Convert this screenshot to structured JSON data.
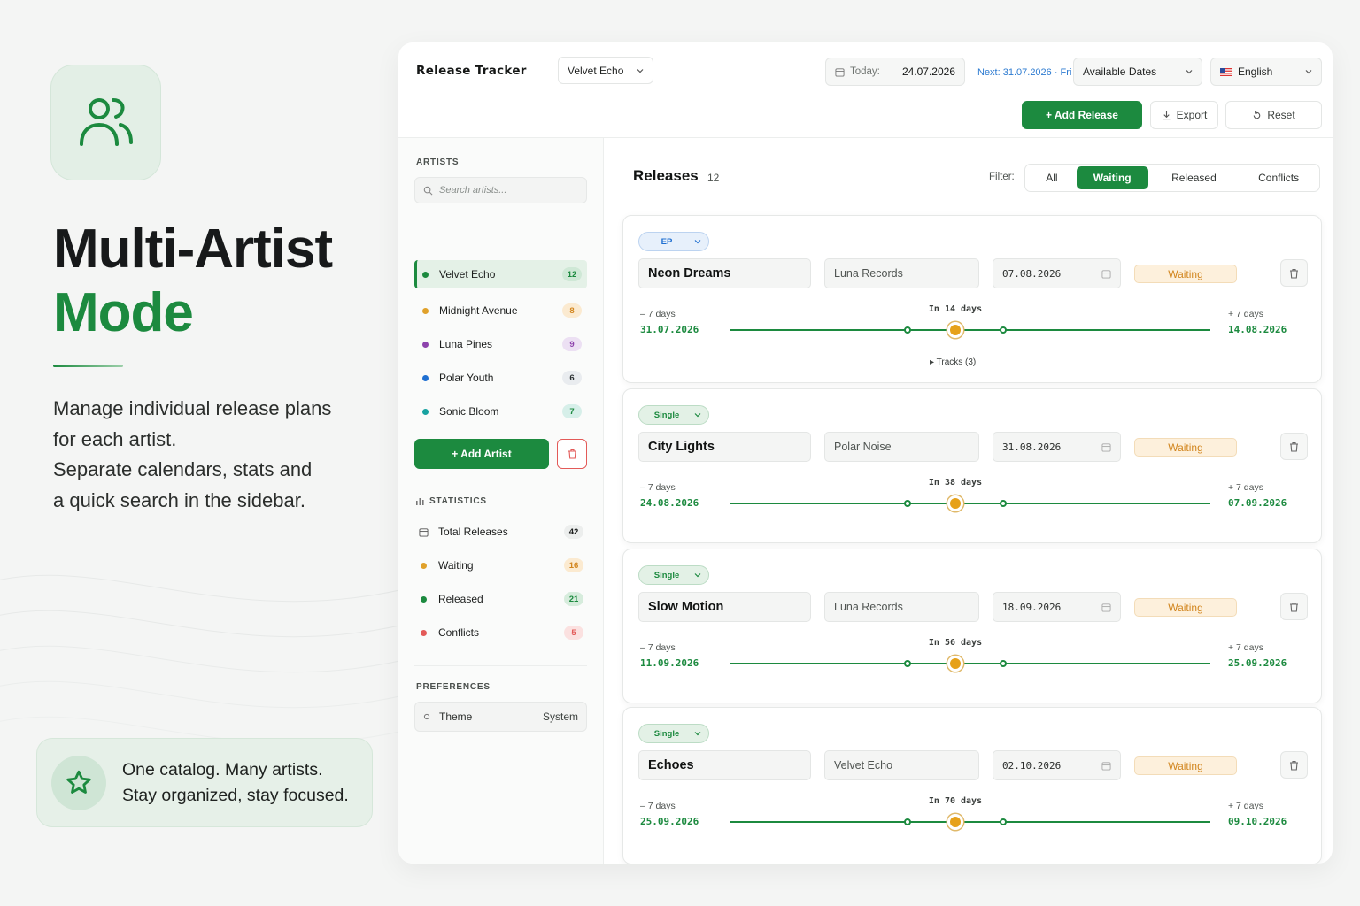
{
  "hero": {
    "title_line1": "Multi-Artist",
    "title_line2": "Mode",
    "desc": [
      "Manage individual release plans",
      "for each artist.",
      "Separate calendars, stats and",
      "a quick search in the sidebar."
    ],
    "card_line1": "One catalog. Many artists.",
    "card_line2": "Stay organized, stay focused."
  },
  "topbar": {
    "brand": "Release Tracker",
    "artist_select": "Velvet Echo",
    "today_label": "Today:",
    "today_value": "24.07.2026",
    "next": "Next: 31.07.2026 · Fri",
    "dates_select": "Available Dates",
    "language": "English",
    "add_release": "+ Add Release",
    "export": "Export",
    "reset": "Reset"
  },
  "sidebar": {
    "artists_label": "ARTISTS",
    "search_placeholder": "Search artists...",
    "artists": [
      {
        "name": "Velvet Echo",
        "count": "12",
        "color": "#1c8a3f"
      },
      {
        "name": "Midnight Avenue",
        "count": "8",
        "color": "#e0a12a"
      },
      {
        "name": "Luna Pines",
        "count": "9",
        "color": "#8e44ad"
      },
      {
        "name": "Polar Youth",
        "count": "6",
        "color": "#1f6fd1"
      },
      {
        "name": "Sonic Bloom",
        "count": "7",
        "color": "#17a2a0"
      }
    ],
    "add_artist": "+ Add Artist",
    "stats_label": "STATISTICS",
    "stats": [
      {
        "label": "Total Releases",
        "value": "42"
      },
      {
        "label": "Waiting",
        "value": "16"
      },
      {
        "label": "Released",
        "value": "21"
      },
      {
        "label": "Conflicts",
        "value": "5"
      }
    ],
    "prefs_label": "PREFERENCES",
    "theme_label": "Theme",
    "theme_value": "System"
  },
  "main": {
    "title": "Releases",
    "count": "12",
    "filter_label": "Filter:",
    "filters": [
      "All",
      "Waiting",
      "Released",
      "Conflicts"
    ],
    "active_filter": "Waiting"
  },
  "releases": [
    {
      "type": "EP",
      "title": "Neon Dreams",
      "label": "Luna Records",
      "date": "07.08.2026",
      "status": "Waiting",
      "minus_label": "– 7 days",
      "minus_date": "31.07.2026",
      "plus_label": "+ 7 days",
      "plus_date": "14.08.2026",
      "in_days": "In 14 days",
      "tracks": "Tracks (3)"
    },
    {
      "type": "Single",
      "title": "City Lights",
      "label": "Polar Noise",
      "date": "31.08.2026",
      "status": "Waiting",
      "minus_label": "– 7 days",
      "minus_date": "24.08.2026",
      "plus_label": "+ 7 days",
      "plus_date": "07.09.2026",
      "in_days": "In 38 days"
    },
    {
      "type": "Single",
      "title": "Slow Motion",
      "label": "Luna Records",
      "date": "18.09.2026",
      "status": "Waiting",
      "minus_label": "– 7 days",
      "minus_date": "11.09.2026",
      "plus_label": "+ 7 days",
      "plus_date": "25.09.2026",
      "in_days": "In 56 days"
    },
    {
      "type": "Single",
      "title": "Echoes",
      "label": "Velvet Echo",
      "date": "02.10.2026",
      "status": "Waiting",
      "minus_label": "– 7 days",
      "minus_date": "25.09.2026",
      "plus_label": "+ 7 days",
      "plus_date": "09.10.2026",
      "in_days": "In 70 days"
    }
  ],
  "colors": {
    "accent": "#1c8a3f",
    "waiting": "#d2861f",
    "conflict": "#e35a58",
    "link": "#2d7bd1"
  }
}
